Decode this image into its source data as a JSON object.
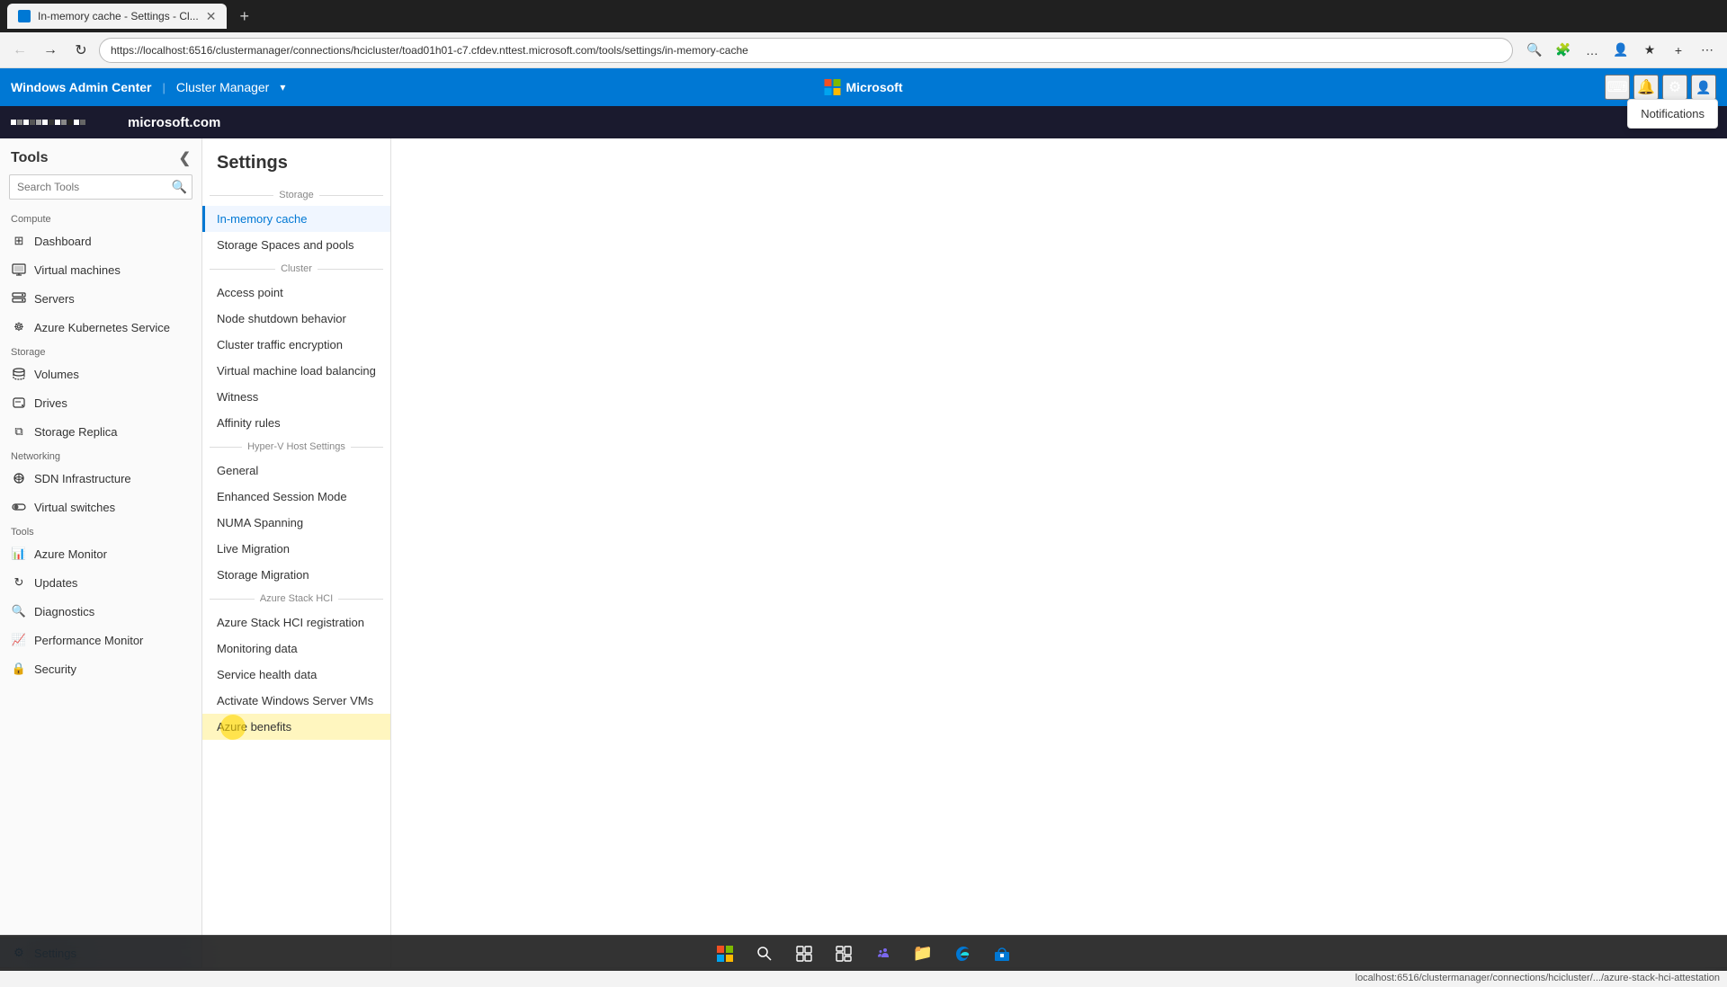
{
  "browser": {
    "tab_title": "In-memory cache - Settings - Cl...",
    "tab_favicon": "tab",
    "address": "https://localhost:6516/clustermanager/connections/hcicluster/toad01h01-c7.cfdev.nttest.microsoft.com/tools/settings/in-memory-cache",
    "new_tab": "+"
  },
  "app_bar": {
    "title": "Windows Admin Center",
    "separator": "|",
    "cluster_manager": "Cluster Manager",
    "microsoft": "Microsoft",
    "terminal_icon": "⌨",
    "bell_icon": "🔔",
    "gear_icon": "⚙",
    "notifications_label": "Notifications"
  },
  "org_header": {
    "logo_text": "microsoft.com"
  },
  "sidebar": {
    "title": "Tools",
    "collapse_icon": "❮",
    "search_placeholder": "Search Tools",
    "sections": [
      {
        "label": "Compute",
        "items": [
          {
            "id": "dashboard",
            "label": "Dashboard",
            "icon": "⊞"
          },
          {
            "id": "virtual-machines",
            "label": "Virtual machines",
            "icon": "☐"
          },
          {
            "id": "servers",
            "label": "Servers",
            "icon": "▣"
          },
          {
            "id": "azure-kubernetes",
            "label": "Azure Kubernetes Service",
            "icon": "⬡"
          }
        ]
      },
      {
        "label": "Storage",
        "items": [
          {
            "id": "volumes",
            "label": "Volumes",
            "icon": "⬡"
          },
          {
            "id": "drives",
            "label": "Drives",
            "icon": "◉"
          },
          {
            "id": "storage-replica",
            "label": "Storage Replica",
            "icon": "⧉"
          }
        ]
      },
      {
        "label": "Networking",
        "items": [
          {
            "id": "sdn-infrastructure",
            "label": "SDN Infrastructure",
            "icon": "⊞"
          },
          {
            "id": "virtual-switches",
            "label": "Virtual switches",
            "icon": "⊕"
          }
        ]
      },
      {
        "label": "Tools",
        "items": [
          {
            "id": "azure-monitor",
            "label": "Azure Monitor",
            "icon": "📊"
          },
          {
            "id": "updates",
            "label": "Updates",
            "icon": "↻"
          },
          {
            "id": "diagnostics",
            "label": "Diagnostics",
            "icon": "🔍"
          },
          {
            "id": "performance-monitor",
            "label": "Performance Monitor",
            "icon": "📈"
          },
          {
            "id": "security",
            "label": "Security",
            "icon": "🔒"
          }
        ]
      }
    ],
    "bottom_item": {
      "id": "settings",
      "label": "Settings",
      "icon": "⚙"
    }
  },
  "settings": {
    "title": "Settings",
    "sections": [
      {
        "label": "Storage",
        "items": [
          {
            "id": "in-memory-cache",
            "label": "In-memory cache",
            "active": true
          },
          {
            "id": "storage-spaces",
            "label": "Storage Spaces and pools"
          }
        ]
      },
      {
        "label": "Cluster",
        "items": [
          {
            "id": "access-point",
            "label": "Access point"
          },
          {
            "id": "node-shutdown",
            "label": "Node shutdown behavior"
          },
          {
            "id": "cluster-traffic",
            "label": "Cluster traffic encryption"
          },
          {
            "id": "vm-load-balancing",
            "label": "Virtual machine load balancing"
          },
          {
            "id": "witness",
            "label": "Witness"
          },
          {
            "id": "affinity-rules",
            "label": "Affinity rules"
          }
        ]
      },
      {
        "label": "Hyper-V Host Settings",
        "items": [
          {
            "id": "general",
            "label": "General"
          },
          {
            "id": "enhanced-session",
            "label": "Enhanced Session Mode"
          },
          {
            "id": "numa-spanning",
            "label": "NUMA Spanning"
          },
          {
            "id": "live-migration",
            "label": "Live Migration"
          },
          {
            "id": "storage-migration",
            "label": "Storage Migration"
          }
        ]
      },
      {
        "label": "Azure Stack HCI",
        "items": [
          {
            "id": "azure-stack-reg",
            "label": "Azure Stack HCI registration"
          },
          {
            "id": "monitoring-data",
            "label": "Monitoring data"
          },
          {
            "id": "service-health",
            "label": "Service health data"
          },
          {
            "id": "activate-windows",
            "label": "Activate Windows Server VMs"
          },
          {
            "id": "azure-benefits",
            "label": "Azure benefits"
          }
        ]
      }
    ]
  },
  "status_bar": {
    "url": "localhost:6516/clustermanager/connections/hcicluster/.../azure-stack-hci-attestation"
  },
  "taskbar": {
    "start_icon": "⊞",
    "search_icon": "🔍",
    "taskview_icon": "❑",
    "widgets_icon": "▦",
    "teams_icon": "👥",
    "explorer_icon": "📁",
    "edge_icon": "🌐",
    "store_icon": "🛒"
  }
}
